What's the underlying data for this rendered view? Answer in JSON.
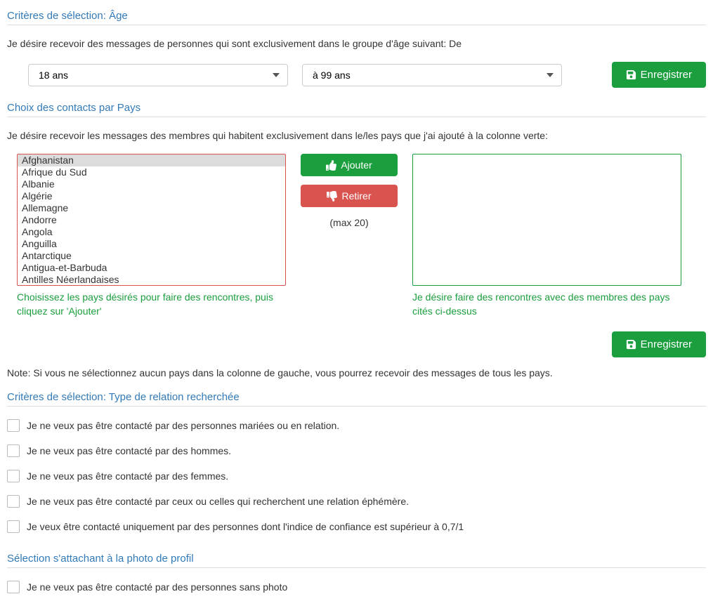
{
  "colors": {
    "primary": "#337ab7",
    "success": "#1b9e3e",
    "danger": "#d9534f"
  },
  "age_section": {
    "header": "Critères de sélection: Âge",
    "description": "Je désire recevoir des messages de personnes qui sont exclusivement dans le groupe d'âge suivant: De",
    "from_value": "18 ans",
    "to_value": "à 99 ans",
    "save_label": "Enregistrer"
  },
  "country_section": {
    "header": "Choix des contacts par Pays",
    "description": "Je désire recevoir les messages des membres qui habitent exclusivement dans le/les pays que j'ai ajouté à la colonne verte:",
    "source_hint": "Choisissez les pays désirés pour faire des rencontres, puis cliquez sur 'Ajouter'",
    "target_hint": "Je désire faire des rencontres avec des membres des pays cités ci-dessus",
    "add_label": "Ajouter",
    "remove_label": "Retirer",
    "max_text": "(max 20)",
    "save_label": "Enregistrer",
    "countries": [
      "Afghanistan",
      "Afrique du Sud",
      "Albanie",
      "Algérie",
      "Allemagne",
      "Andorre",
      "Angola",
      "Anguilla",
      "Antarctique",
      "Antigua-et-Barbuda",
      "Antilles Néerlandaises"
    ],
    "selected_index": 0,
    "note": "Note: Si vous ne sélectionnez aucun pays dans la colonne de gauche, vous pourrez recevoir des messages de tous les pays."
  },
  "relation_section": {
    "header": "Critères de sélection: Type de relation recherchée",
    "options": [
      "Je ne veux pas être contacté par des personnes mariées ou en relation.",
      "Je ne veux pas être contacté par des hommes.",
      "Je ne veux pas être contacté par des femmes.",
      "Je ne veux pas être contacté par ceux ou celles qui recherchent une relation éphémère.",
      "Je veux être contacté uniquement par des personnes dont l'indice de confiance est supérieur à 0,7/1"
    ]
  },
  "photo_section": {
    "header": "Sélection s'attachant à la photo de profil",
    "option": "Je ne veux pas être contacté par des personnes sans photo"
  }
}
